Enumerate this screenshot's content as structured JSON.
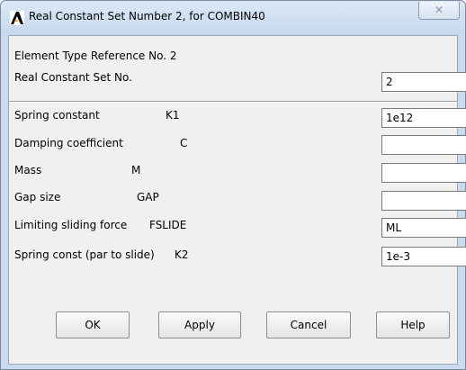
{
  "window": {
    "title": "Real Constant Set Number 2, for COMBIN40",
    "app_icon": "ansys-icon",
    "close_glyph": "✕",
    "accent_color": "#000000",
    "frame_color": "#c9dcef"
  },
  "header": {
    "element_type_ref": "Element Type Reference No. 2",
    "real_const_set_label": "Real Constant Set No.",
    "real_const_set_value": "2"
  },
  "fields": [
    {
      "label": "Spring constant",
      "symbol": "K1",
      "value": "1e12"
    },
    {
      "label": "Damping coefficient",
      "symbol": "C",
      "value": ""
    },
    {
      "label": "Mass",
      "symbol": "M",
      "value": ""
    },
    {
      "label": "Gap size",
      "symbol": "GAP",
      "value": ""
    },
    {
      "label": "Limiting sliding force",
      "symbol": "FSLIDE",
      "value": "ML"
    },
    {
      "label": "Spring const (par to slide)",
      "symbol": "K2",
      "value": "1e-3"
    }
  ],
  "buttons": {
    "ok": "OK",
    "apply": "Apply",
    "cancel": "Cancel",
    "help": "Help"
  }
}
